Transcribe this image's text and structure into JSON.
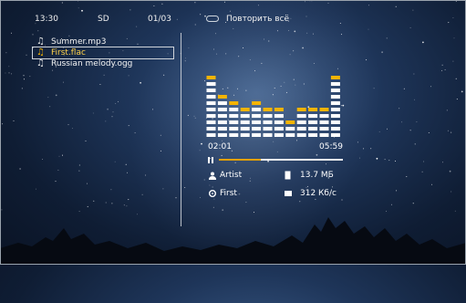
{
  "status": {
    "time": "13:30",
    "source": "SD",
    "track_index": "01/03",
    "repeat_label": "Повторить всё"
  },
  "playlist": [
    {
      "name": "Summer.mp3",
      "selected": false
    },
    {
      "name": "First.flac",
      "selected": true
    },
    {
      "name": "Russian melody.ogg",
      "selected": false
    }
  ],
  "player": {
    "elapsed": "02:01",
    "duration": "05:59",
    "progress": 0.337,
    "artist": "Artist",
    "album": "First",
    "file_size": "13.7 МБ",
    "bitrate": "312 Кб/с"
  },
  "equalizer": {
    "levels": [
      10,
      7,
      6,
      5,
      6,
      5,
      5,
      3,
      5,
      5,
      5,
      10
    ],
    "max": 10
  },
  "colors": {
    "accent": "#f6b400",
    "highlight": "#ffd24a",
    "text": "#ffffff"
  },
  "icons": {
    "track": "music-note-icon",
    "pause": "pause-icon",
    "artist": "person-icon",
    "album": "disc-icon",
    "size": "file-icon",
    "bitrate": "signal-icon"
  }
}
